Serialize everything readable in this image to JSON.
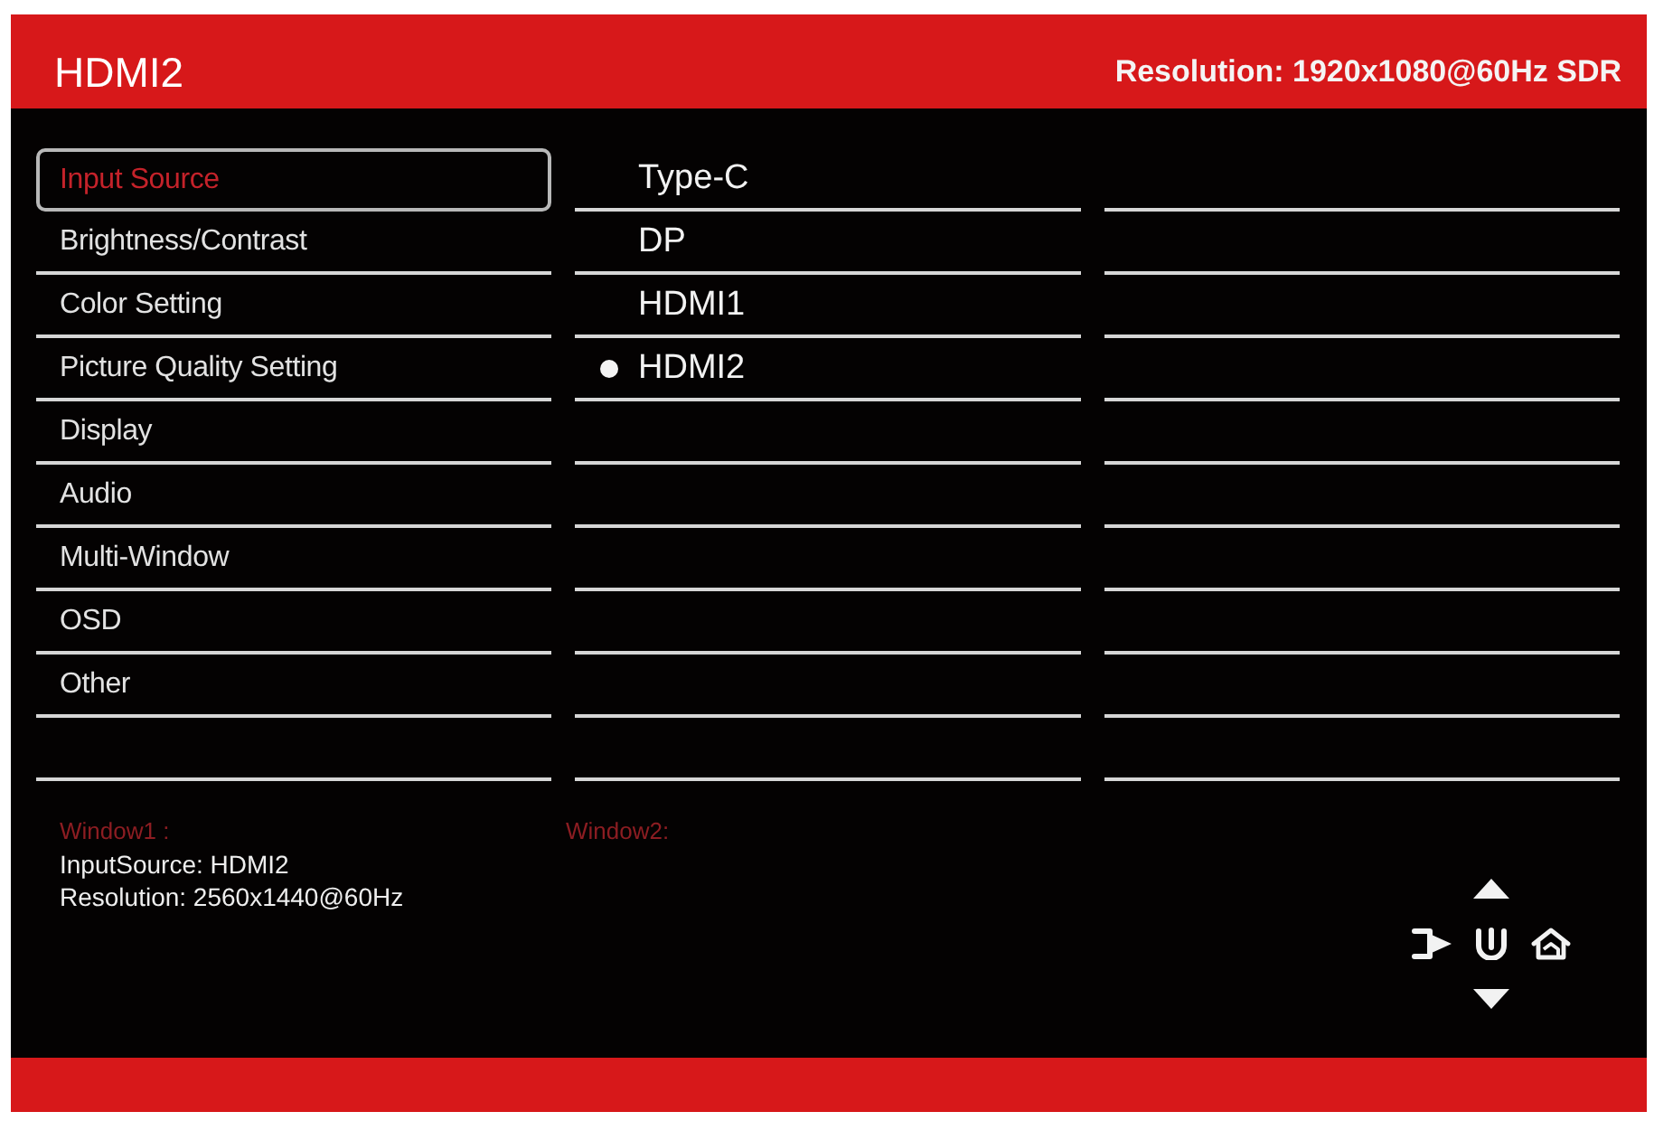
{
  "header": {
    "title": "HDMI2",
    "resolution": "Resolution: 1920x1080@60Hz SDR"
  },
  "menu": {
    "items": [
      {
        "label": "Input Source",
        "selected": true
      },
      {
        "label": "Brightness/Contrast",
        "selected": false
      },
      {
        "label": "Color Setting",
        "selected": false
      },
      {
        "label": "Picture Quality Setting",
        "selected": false
      },
      {
        "label": "Display",
        "selected": false
      },
      {
        "label": "Audio",
        "selected": false
      },
      {
        "label": "Multi-Window",
        "selected": false
      },
      {
        "label": "OSD",
        "selected": false
      },
      {
        "label": "Other",
        "selected": false
      }
    ]
  },
  "options": [
    {
      "label": "Type-C",
      "selected": false
    },
    {
      "label": "DP",
      "selected": false
    },
    {
      "label": "HDMI1",
      "selected": false
    },
    {
      "label": "HDMI2",
      "selected": true
    }
  ],
  "windows": [
    {
      "heading": "Window1 :",
      "lines": [
        "InputSource: HDMI2",
        "Resolution: 2560x1440@60Hz"
      ]
    },
    {
      "heading": "Window2:"
    }
  ]
}
